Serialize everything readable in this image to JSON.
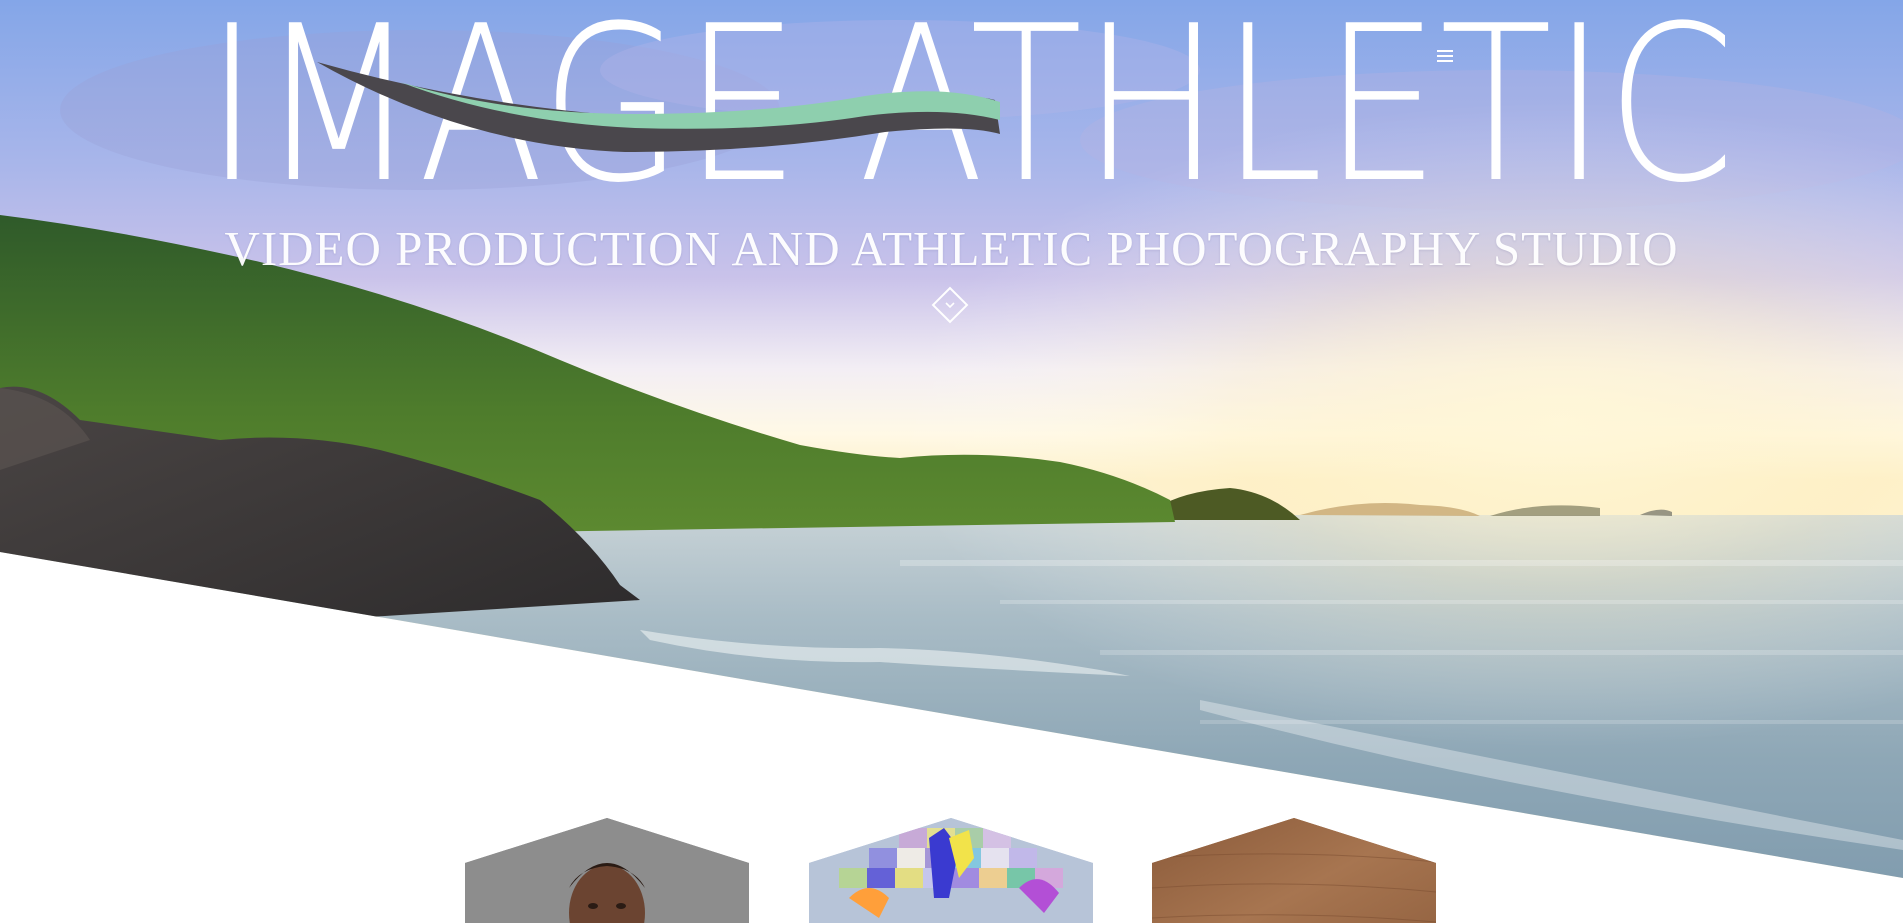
{
  "brand": {
    "logo_text": "IMAGE ATHLETIC",
    "tagline": "VIDEO PRODUCTION AND ATHLETIC PHOTOGRAPHY STUDIO",
    "wave_colors": {
      "teal": "#8ecfae",
      "charcoal": "#4a474c"
    }
  },
  "nav": {
    "menu_icon": "hamburger-icon"
  },
  "hero": {
    "scroll_icon": "chevron-down-icon"
  },
  "portfolio": {
    "tiles": [
      {
        "name": "portrait-tile",
        "content": "athlete portrait"
      },
      {
        "name": "mosaic-tile",
        "content": "colorful illustration"
      },
      {
        "name": "wood-tile",
        "content": "wooden court"
      }
    ]
  },
  "colors": {
    "sky_top": "#8aa8e6",
    "sky_mid": "#b9b6e6",
    "horizon": "#fff6dc",
    "sea": "#9fb4c2",
    "hill": "#3f6a2c",
    "rock": "#3a3636"
  }
}
